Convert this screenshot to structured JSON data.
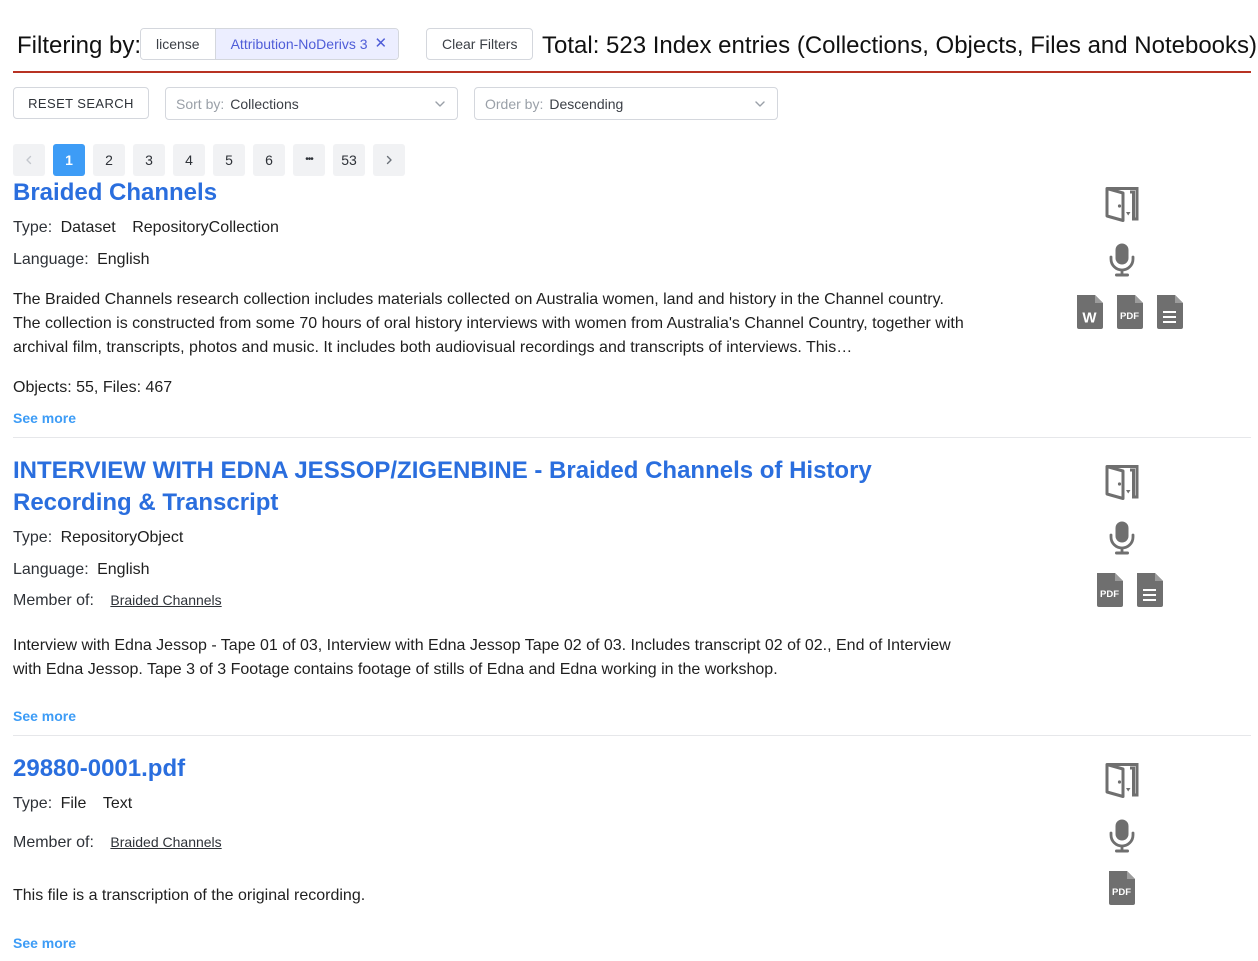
{
  "filters": {
    "label": "Filtering by:",
    "key": "license",
    "value": "Attribution-NoDerivs 3",
    "close_glyph": "✕",
    "clear_label": "Clear Filters",
    "total": "Total: 523 Index entries (Collections, Objects, Files and Notebooks)"
  },
  "controls": {
    "reset_label": "RESET SEARCH",
    "sort_label": "Sort by:",
    "sort_value": "Collections",
    "order_label": "Order by:",
    "order_value": "Descending"
  },
  "pagination": {
    "prev_icon": "chevron-left-icon",
    "next_icon": "chevron-right-icon",
    "pages": [
      "1",
      "2",
      "3",
      "4",
      "5",
      "6",
      "•••",
      "53"
    ],
    "current": "1"
  },
  "results": [
    {
      "title": "Braided Channels",
      "type_label": "Type:",
      "types": [
        "Dataset",
        "RepositoryCollection"
      ],
      "language_label": "Language:",
      "language": "English",
      "description": "The Braided Channels research collection includes materials collected on Australia women, land and history in the Channel country. The collection is constructed from some 70 hours of oral history interviews with women from Australia's Channel Country, together with archival film, transcripts, photos and music. It includes both audiovisual recordings and transcripts of interviews. This…",
      "counts": "Objects: 55, Files: 467",
      "see_more": "See more",
      "icons": [
        "open-door-icon",
        "microphone-icon",
        "word-file-icon",
        "pdf-file-icon",
        "text-file-icon"
      ]
    },
    {
      "title": "INTERVIEW WITH EDNA JESSOP/ZIGENBINE - Braided Channels of History Recording & Transcript",
      "type_label": "Type:",
      "types": [
        "RepositoryObject"
      ],
      "language_label": "Language:",
      "language": "English",
      "member_label": "Member of:",
      "member": "Braided Channels",
      "description": "Interview with Edna Jessop - Tape 01 of 03, Interview with Edna Jessop Tape 02 of 03. Includes transcript 02 of 02., End of Interview with Edna Jessop. Tape 3 of 3 Footage contains footage of stills of Edna and Edna working in the workshop.",
      "see_more": "See more",
      "icons": [
        "open-door-icon",
        "microphone-icon",
        "pdf-file-icon",
        "text-file-icon"
      ]
    },
    {
      "title": "29880-0001.pdf",
      "type_label": "Type:",
      "types": [
        "File",
        "Text"
      ],
      "member_label": "Member of:",
      "member": "Braided Channels",
      "description": "This file is a transcription of the original recording.",
      "see_more": "See more",
      "icons": [
        "open-door-icon",
        "microphone-icon",
        "pdf-file-icon"
      ]
    }
  ],
  "file_badges": {
    "word": "W",
    "pdf": "PDF"
  },
  "colors": {
    "link": "#2a6ede",
    "accent": "#3d9cf6",
    "divider": "#b83223",
    "icon": "#6f6f6f",
    "tag_text": "#4f5dd8",
    "tag_bg": "#eceeff"
  }
}
